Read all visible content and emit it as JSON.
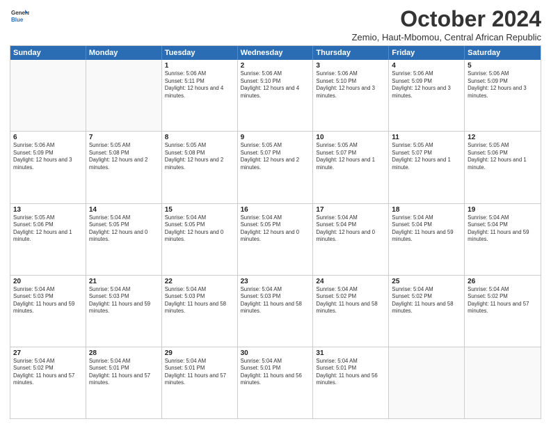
{
  "logo": {
    "general": "General",
    "blue": "Blue"
  },
  "title": "October 2024",
  "subtitle": "Zemio, Haut-Mbomou, Central African Republic",
  "weekdays": [
    "Sunday",
    "Monday",
    "Tuesday",
    "Wednesday",
    "Thursday",
    "Friday",
    "Saturday"
  ],
  "weeks": [
    [
      {
        "day": "",
        "info": ""
      },
      {
        "day": "",
        "info": ""
      },
      {
        "day": "1",
        "info": "Sunrise: 5:06 AM\nSunset: 5:11 PM\nDaylight: 12 hours and 4 minutes."
      },
      {
        "day": "2",
        "info": "Sunrise: 5:06 AM\nSunset: 5:10 PM\nDaylight: 12 hours and 4 minutes."
      },
      {
        "day": "3",
        "info": "Sunrise: 5:06 AM\nSunset: 5:10 PM\nDaylight: 12 hours and 3 minutes."
      },
      {
        "day": "4",
        "info": "Sunrise: 5:06 AM\nSunset: 5:09 PM\nDaylight: 12 hours and 3 minutes."
      },
      {
        "day": "5",
        "info": "Sunrise: 5:06 AM\nSunset: 5:09 PM\nDaylight: 12 hours and 3 minutes."
      }
    ],
    [
      {
        "day": "6",
        "info": "Sunrise: 5:06 AM\nSunset: 5:09 PM\nDaylight: 12 hours and 3 minutes."
      },
      {
        "day": "7",
        "info": "Sunrise: 5:05 AM\nSunset: 5:08 PM\nDaylight: 12 hours and 2 minutes."
      },
      {
        "day": "8",
        "info": "Sunrise: 5:05 AM\nSunset: 5:08 PM\nDaylight: 12 hours and 2 minutes."
      },
      {
        "day": "9",
        "info": "Sunrise: 5:05 AM\nSunset: 5:07 PM\nDaylight: 12 hours and 2 minutes."
      },
      {
        "day": "10",
        "info": "Sunrise: 5:05 AM\nSunset: 5:07 PM\nDaylight: 12 hours and 1 minute."
      },
      {
        "day": "11",
        "info": "Sunrise: 5:05 AM\nSunset: 5:07 PM\nDaylight: 12 hours and 1 minute."
      },
      {
        "day": "12",
        "info": "Sunrise: 5:05 AM\nSunset: 5:06 PM\nDaylight: 12 hours and 1 minute."
      }
    ],
    [
      {
        "day": "13",
        "info": "Sunrise: 5:05 AM\nSunset: 5:06 PM\nDaylight: 12 hours and 1 minute."
      },
      {
        "day": "14",
        "info": "Sunrise: 5:04 AM\nSunset: 5:05 PM\nDaylight: 12 hours and 0 minutes."
      },
      {
        "day": "15",
        "info": "Sunrise: 5:04 AM\nSunset: 5:05 PM\nDaylight: 12 hours and 0 minutes."
      },
      {
        "day": "16",
        "info": "Sunrise: 5:04 AM\nSunset: 5:05 PM\nDaylight: 12 hours and 0 minutes."
      },
      {
        "day": "17",
        "info": "Sunrise: 5:04 AM\nSunset: 5:04 PM\nDaylight: 12 hours and 0 minutes."
      },
      {
        "day": "18",
        "info": "Sunrise: 5:04 AM\nSunset: 5:04 PM\nDaylight: 11 hours and 59 minutes."
      },
      {
        "day": "19",
        "info": "Sunrise: 5:04 AM\nSunset: 5:04 PM\nDaylight: 11 hours and 59 minutes."
      }
    ],
    [
      {
        "day": "20",
        "info": "Sunrise: 5:04 AM\nSunset: 5:03 PM\nDaylight: 11 hours and 59 minutes."
      },
      {
        "day": "21",
        "info": "Sunrise: 5:04 AM\nSunset: 5:03 PM\nDaylight: 11 hours and 59 minutes."
      },
      {
        "day": "22",
        "info": "Sunrise: 5:04 AM\nSunset: 5:03 PM\nDaylight: 11 hours and 58 minutes."
      },
      {
        "day": "23",
        "info": "Sunrise: 5:04 AM\nSunset: 5:03 PM\nDaylight: 11 hours and 58 minutes."
      },
      {
        "day": "24",
        "info": "Sunrise: 5:04 AM\nSunset: 5:02 PM\nDaylight: 11 hours and 58 minutes."
      },
      {
        "day": "25",
        "info": "Sunrise: 5:04 AM\nSunset: 5:02 PM\nDaylight: 11 hours and 58 minutes."
      },
      {
        "day": "26",
        "info": "Sunrise: 5:04 AM\nSunset: 5:02 PM\nDaylight: 11 hours and 57 minutes."
      }
    ],
    [
      {
        "day": "27",
        "info": "Sunrise: 5:04 AM\nSunset: 5:02 PM\nDaylight: 11 hours and 57 minutes."
      },
      {
        "day": "28",
        "info": "Sunrise: 5:04 AM\nSunset: 5:01 PM\nDaylight: 11 hours and 57 minutes."
      },
      {
        "day": "29",
        "info": "Sunrise: 5:04 AM\nSunset: 5:01 PM\nDaylight: 11 hours and 57 minutes."
      },
      {
        "day": "30",
        "info": "Sunrise: 5:04 AM\nSunset: 5:01 PM\nDaylight: 11 hours and 56 minutes."
      },
      {
        "day": "31",
        "info": "Sunrise: 5:04 AM\nSunset: 5:01 PM\nDaylight: 11 hours and 56 minutes."
      },
      {
        "day": "",
        "info": ""
      },
      {
        "day": "",
        "info": ""
      }
    ]
  ]
}
